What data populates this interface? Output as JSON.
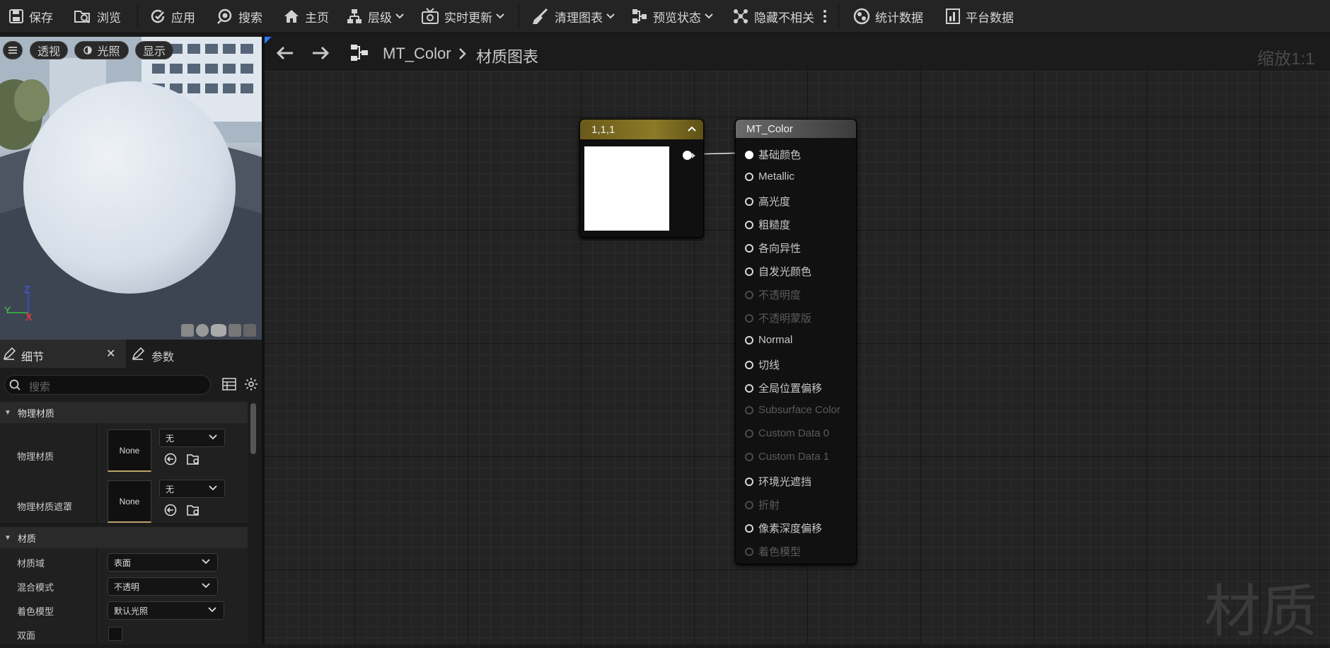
{
  "toolbar": {
    "save": "保存",
    "browse": "浏览",
    "apply": "应用",
    "search": "搜索",
    "home": "主页",
    "hierarchy": "层级",
    "live_update": "实时更新",
    "clean_graph": "清理图表",
    "preview_state": "预览状态",
    "hide_unrelated": "隐藏不相关",
    "stats": "统计数据",
    "platform_stats": "平台数据"
  },
  "viewport": {
    "perspective": "透视",
    "lighting": "光照",
    "show": "显示",
    "axis_z": "Z",
    "axis_y": "Y",
    "axis_x": "X"
  },
  "details": {
    "tab_details": "细节",
    "tab_params": "参数",
    "search_placeholder": "搜索",
    "section_physical": "物理材质",
    "phys_mat_label": "物理材质",
    "phys_mat_value": "None",
    "phys_mat_dropdown": "无",
    "phys_mask_label": "物理材质遮罩",
    "phys_mask_value": "None",
    "phys_mask_dropdown": "无",
    "section_material": "材质",
    "domain_label": "材质域",
    "domain_value": "表面",
    "blend_label": "混合模式",
    "blend_value": "不透明",
    "shading_label": "着色模型",
    "shading_value": "默认光照",
    "twosided_label": "双面"
  },
  "graph": {
    "breadcrumb_asset": "MT_Color",
    "breadcrumb_graph": "材质图表",
    "zoom": "缩放1:1",
    "watermark": "材质",
    "const_node_title": "1,1,1",
    "const_color": "#ffffff",
    "result_node_title": "MT_Color",
    "pins": [
      {
        "label": "基础颜色",
        "enabled": true,
        "connected": true
      },
      {
        "label": "Metallic",
        "enabled": true,
        "connected": false
      },
      {
        "label": "高光度",
        "enabled": true,
        "connected": false
      },
      {
        "label": "粗糙度",
        "enabled": true,
        "connected": false
      },
      {
        "label": "各向异性",
        "enabled": true,
        "connected": false
      },
      {
        "label": "自发光颜色",
        "enabled": true,
        "connected": false
      },
      {
        "label": "不透明度",
        "enabled": false,
        "connected": false
      },
      {
        "label": "不透明蒙版",
        "enabled": false,
        "connected": false
      },
      {
        "label": "Normal",
        "enabled": true,
        "connected": false
      },
      {
        "label": "切线",
        "enabled": true,
        "connected": false
      },
      {
        "label": "全局位置偏移",
        "enabled": true,
        "connected": false
      },
      {
        "label": "Subsurface Color",
        "enabled": false,
        "connected": false
      },
      {
        "label": "Custom Data 0",
        "enabled": false,
        "connected": false
      },
      {
        "label": "Custom Data 1",
        "enabled": false,
        "connected": false
      },
      {
        "label": "环境光遮挡",
        "enabled": true,
        "connected": false
      },
      {
        "label": "折射",
        "enabled": false,
        "connected": false
      },
      {
        "label": "像素深度偏移",
        "enabled": true,
        "connected": false
      },
      {
        "label": "着色模型",
        "enabled": false,
        "connected": false
      }
    ]
  }
}
